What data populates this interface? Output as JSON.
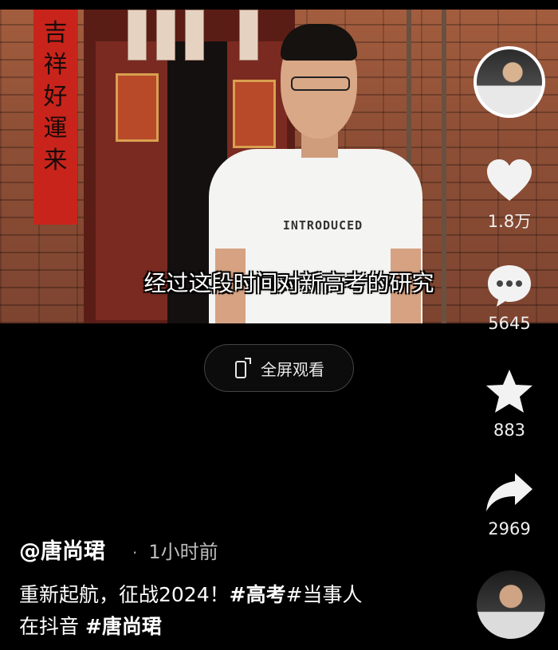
{
  "video": {
    "subtitle": "经过这段时间对新高考的研究",
    "shirt_text": "INTRODUCED",
    "banner_text": "吉祥好運来"
  },
  "fullscreen": {
    "label": "全屏观看",
    "icon": "fullscreen-phone-icon"
  },
  "actions": {
    "like": {
      "icon": "heart-icon",
      "count": "1.8万"
    },
    "comment": {
      "icon": "comment-bubble-icon",
      "count": "5645"
    },
    "favorite": {
      "icon": "star-icon",
      "count": "883"
    },
    "share": {
      "icon": "share-arrow-icon",
      "count": "2969"
    }
  },
  "author": {
    "name": "@唐尚珺",
    "separator": "·",
    "time": "1小时前"
  },
  "caption": {
    "text": "重新起航，征战2024！",
    "tag1": "#高考",
    "tag2": "#当事人",
    "line2_prefix": "在抖音 ",
    "tag3": "#唐尚珺"
  },
  "colors": {
    "background": "#000000",
    "text": "#ffffff",
    "secondary": "#bdbdbd"
  }
}
